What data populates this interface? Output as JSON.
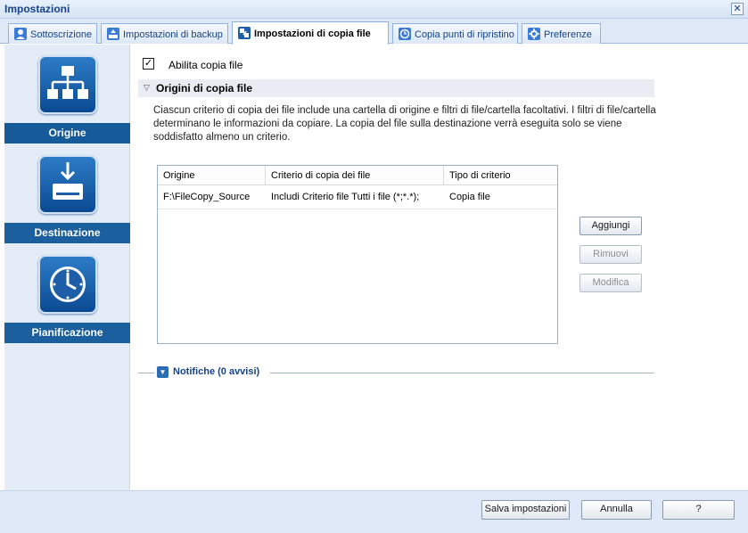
{
  "window": {
    "title": "Impostazioni",
    "close_glyph": "✕"
  },
  "tabs": [
    {
      "label": "Sottoscrizione",
      "icon": "user-icon",
      "color": "#3a7bd5"
    },
    {
      "label": "Impostazioni di backup",
      "icon": "backup-icon",
      "color": "#3a7bd5"
    },
    {
      "label": "Impostazioni di copia file",
      "icon": "file-copy-icon",
      "color": "#1e5ea8",
      "active": true
    },
    {
      "label": "Copia punti di ripristino",
      "icon": "restore-points-icon",
      "color": "#3a7bd5"
    },
    {
      "label": "Preferenze",
      "icon": "preferences-icon",
      "color": "#3a7bd5"
    }
  ],
  "sidebar": {
    "items": [
      {
        "label": "Origine",
        "icon": "source-hierarchy-icon"
      },
      {
        "label": "Destinazione",
        "icon": "destination-drive-icon"
      },
      {
        "label": "Pianificazione",
        "icon": "schedule-clock-icon"
      }
    ]
  },
  "main": {
    "enable_checkbox": {
      "label": "Abilita copia file",
      "checked": true,
      "mark": "✓"
    },
    "section": {
      "title": "Origini di copia file",
      "collapse_glyph": "▽",
      "description": "Ciascun criterio di copia dei file include una cartella di origine e filtri di file/cartella facoltativi. I filtri di file/cartella determinano le informazioni da copiare. La copia del file sulla destinazione verrà eseguita solo se viene soddisfatto almeno un criterio."
    },
    "table": {
      "columns": [
        "Origine",
        "Criterio di copia dei file",
        "Tipo di criterio"
      ],
      "rows": [
        [
          "F:\\FileCopy_Source",
          "Includi Criterio file Tutti i file (*;*.*);",
          "Copia file"
        ]
      ]
    },
    "buttons": {
      "add": "Aggiungi",
      "remove": "Rimuovi",
      "modify": "Modifica"
    },
    "notifications": {
      "label": "Notifiche (0 avvisi)",
      "expand_glyph": "▼"
    }
  },
  "footer": {
    "save": "Salva impostazioni",
    "cancel": "Annulla",
    "help": "?"
  },
  "colors": {
    "accent": "#15428b",
    "nav_label_bg": "#1b5f9e",
    "panel_bg": "#dfe8f6"
  }
}
